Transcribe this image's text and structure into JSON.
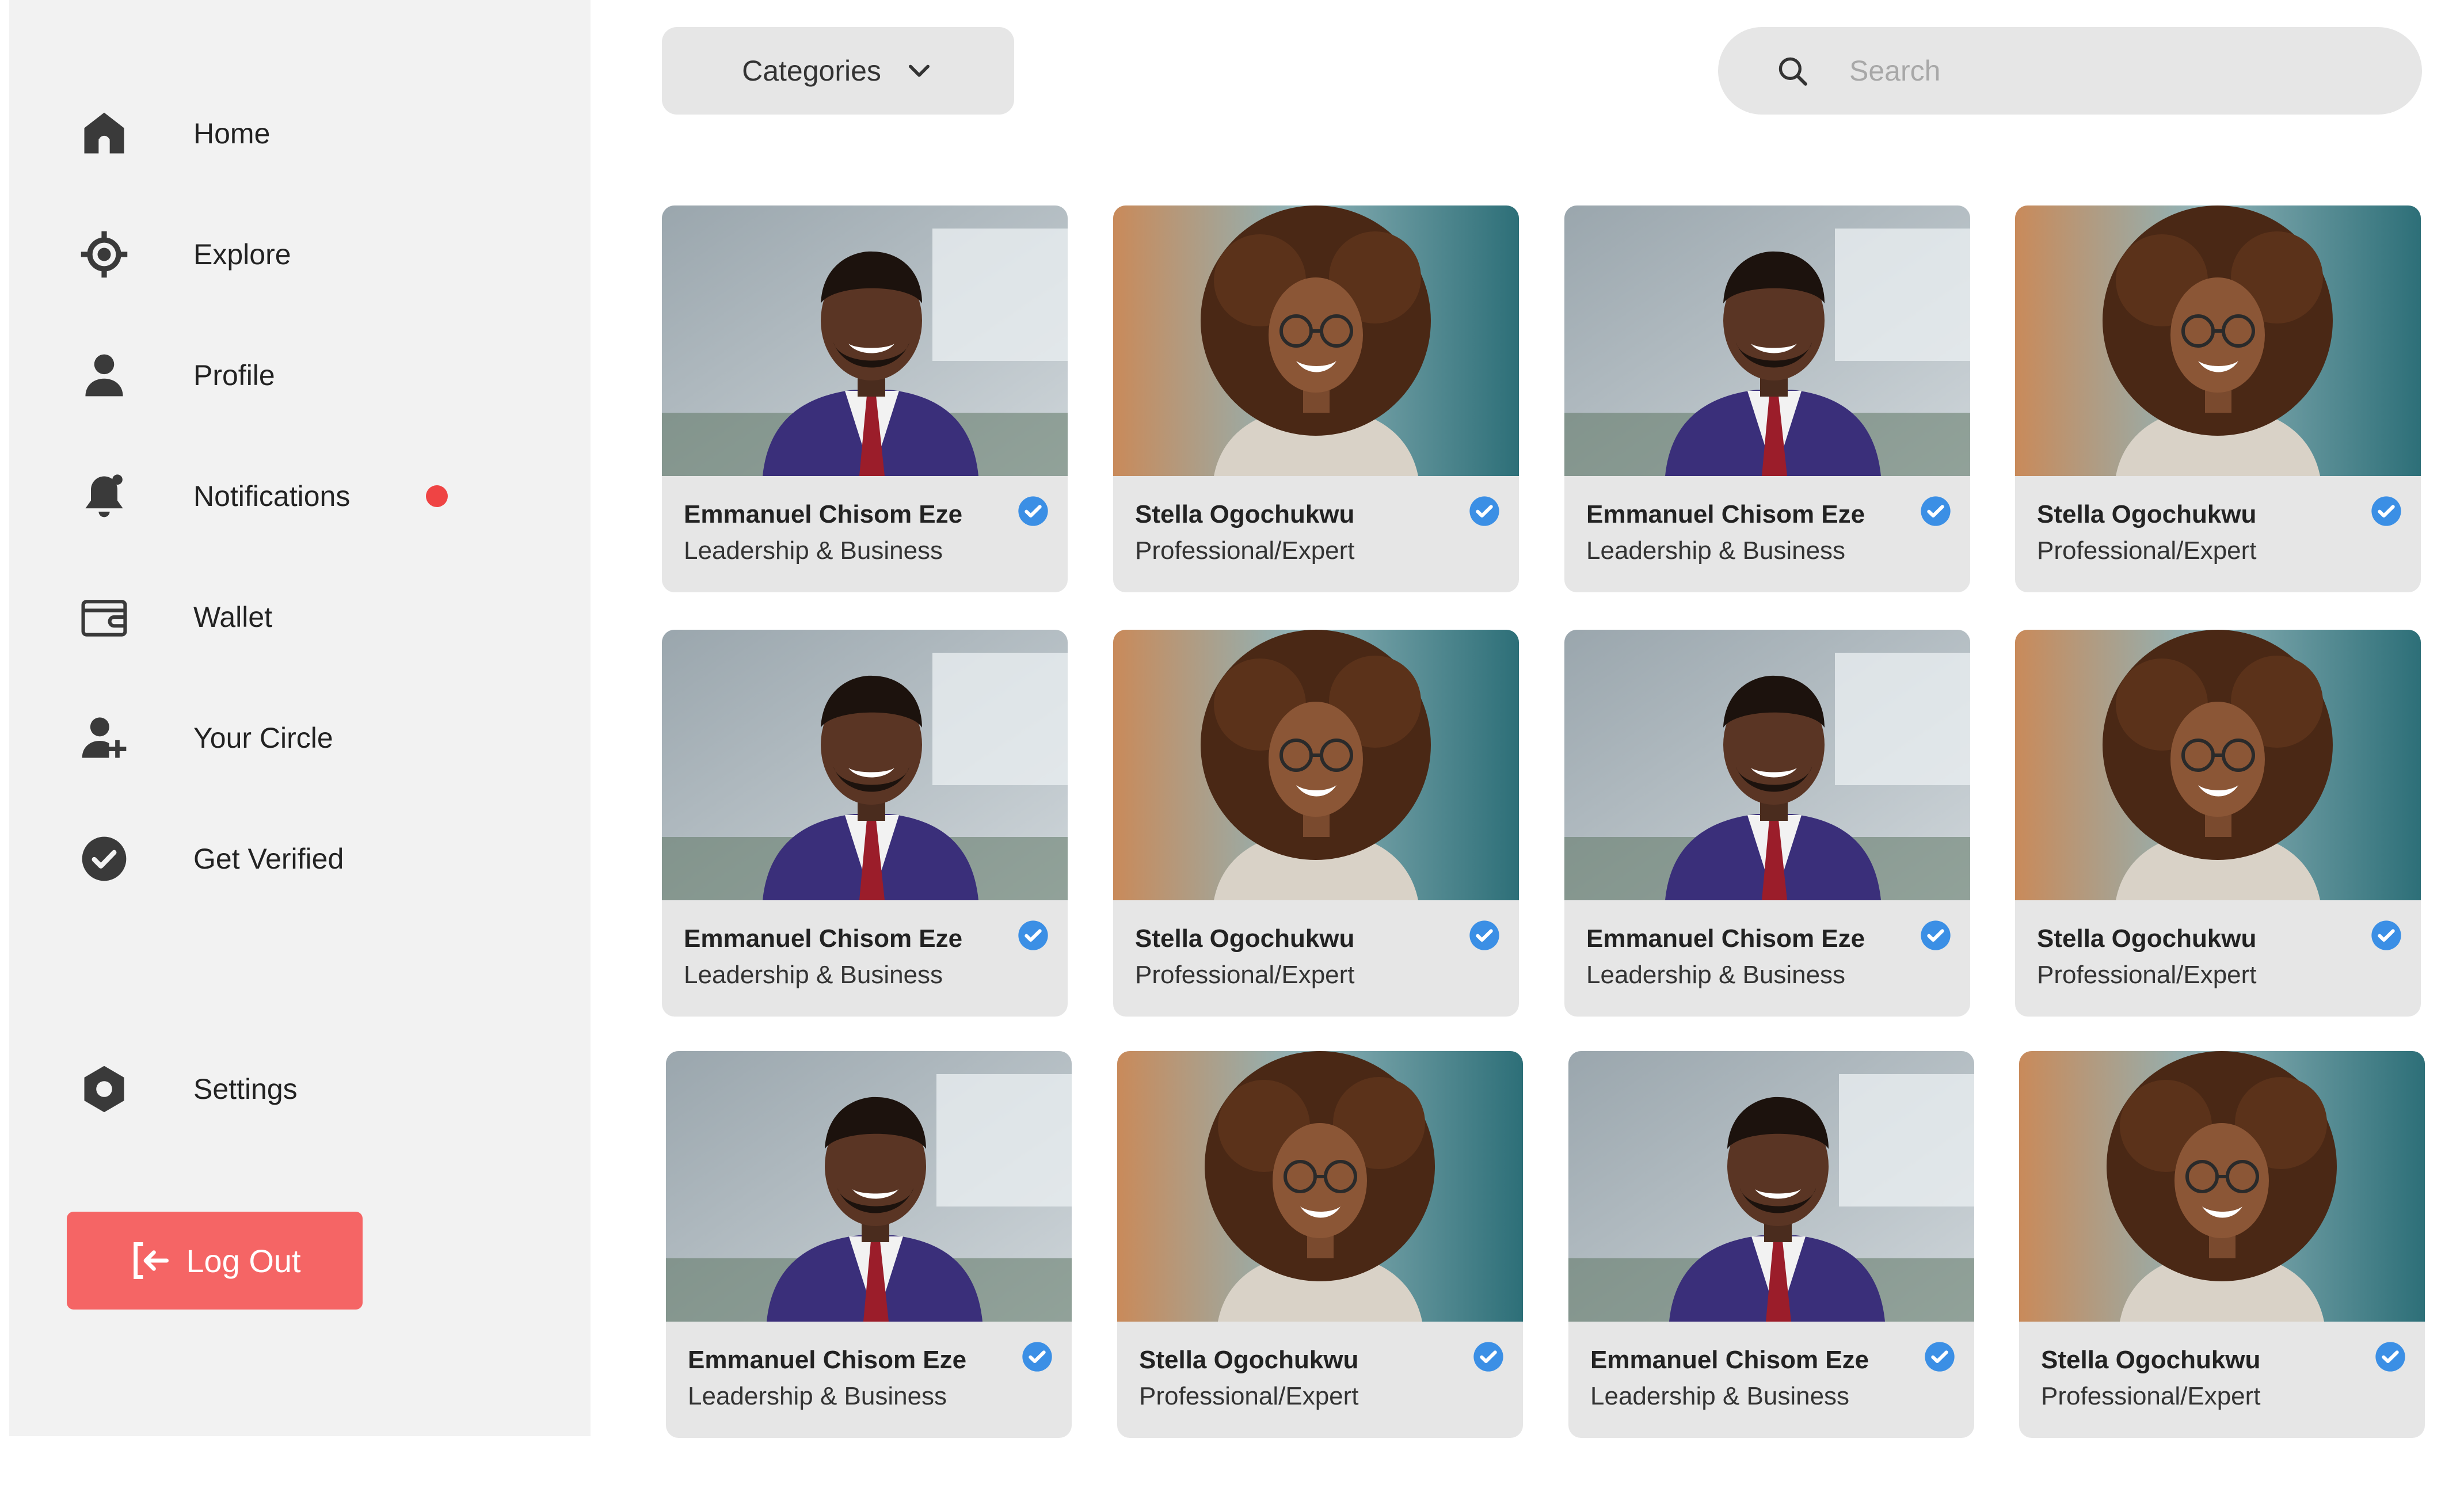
{
  "sidebar": {
    "items": [
      {
        "label": "Home",
        "icon": "home-icon"
      },
      {
        "label": "Explore",
        "icon": "crosshair-icon"
      },
      {
        "label": "Profile",
        "icon": "user-icon"
      },
      {
        "label": "Notifications",
        "icon": "bell-icon",
        "has_badge": true
      },
      {
        "label": "Wallet",
        "icon": "wallet-icon"
      },
      {
        "label": "Your Circle",
        "icon": "add-user-icon"
      },
      {
        "label": "Get Verified",
        "icon": "check-circle-icon"
      }
    ],
    "settings": {
      "label": "Settings",
      "icon": "settings-icon"
    },
    "logout": {
      "label": "Log Out",
      "icon": "logout-icon"
    }
  },
  "toolbar": {
    "categories_label": "Categories",
    "search_placeholder": "Search",
    "search_value": ""
  },
  "colors": {
    "sidebar_bg": "#f2f2f2",
    "control_bg": "#e6e6e6",
    "logout_bg": "#f56565",
    "notification_dot": "#ef4444",
    "verified_badge": "#3b8fe5",
    "icon_dark": "#3a3a3a"
  },
  "cards": [
    {
      "name": "Emmanuel Chisom Eze",
      "role": "Leadership & Business",
      "verified": true
    },
    {
      "name": "Stella Ogochukwu",
      "role": "Professional/Expert",
      "verified": true
    },
    {
      "name": "Emmanuel Chisom Eze",
      "role": "Leadership & Business",
      "verified": true
    },
    {
      "name": "Stella Ogochukwu",
      "role": "Professional/Expert",
      "verified": true
    },
    {
      "name": "Emmanuel Chisom Eze",
      "role": "Leadership & Business",
      "verified": true
    },
    {
      "name": "Stella Ogochukwu",
      "role": "Professional/Expert",
      "verified": true
    },
    {
      "name": "Emmanuel Chisom Eze",
      "role": "Leadership & Business",
      "verified": true
    },
    {
      "name": "Stella Ogochukwu",
      "role": "Professional/Expert",
      "verified": true
    },
    {
      "name": "Emmanuel Chisom Eze",
      "role": "Leadership & Business",
      "verified": true
    },
    {
      "name": "Stella Ogochukwu",
      "role": "Professional/Expert",
      "verified": true
    },
    {
      "name": "Emmanuel Chisom Eze",
      "role": "Leadership & Business",
      "verified": true
    },
    {
      "name": "Stella Ogochukwu",
      "role": "Professional/Expert",
      "verified": true
    }
  ]
}
